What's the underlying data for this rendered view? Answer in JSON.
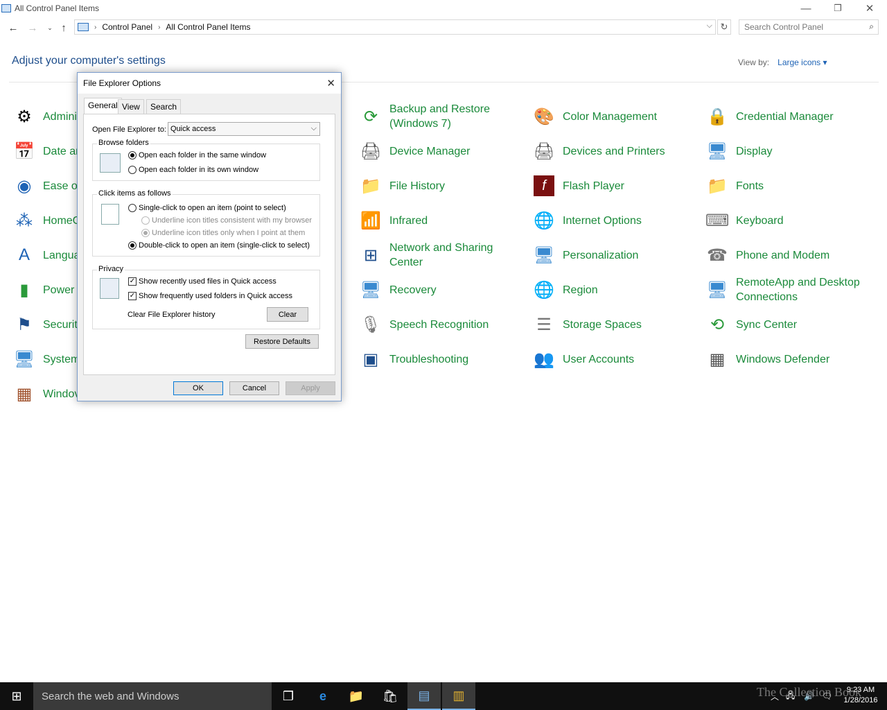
{
  "window": {
    "title": "All Control Panel Items",
    "controls": {
      "minimize": "—",
      "restore": "❐",
      "close": "✕"
    }
  },
  "address": {
    "breadcrumb": [
      "Control Panel",
      "All Control Panel Items"
    ],
    "search_placeholder": "Search Control Panel"
  },
  "header": {
    "title": "Adjust your computer's settings",
    "view_by_label": "View by:",
    "view_by_value": "Large icons"
  },
  "items": [
    {
      "label": "Admini",
      "icon": "admin-tools-icon"
    },
    {
      "label": "Date ar",
      "icon": "datetime-icon"
    },
    {
      "label": "Ease of",
      "icon": "ease-of-access-icon"
    },
    {
      "label": "HomeG",
      "icon": "homegroup-icon"
    },
    {
      "label": "Langua",
      "icon": "language-icon"
    },
    {
      "label": "Power",
      "icon": "power-icon"
    },
    {
      "label": "Securit",
      "icon": "security-flag-icon"
    },
    {
      "label": "System",
      "icon": "system-icon"
    },
    {
      "label": "Windov",
      "icon": "firewall-icon"
    },
    {
      "label": "Backup and Restore (Windows 7)",
      "icon": "backup-icon"
    },
    {
      "label": "Device Manager",
      "icon": "device-manager-icon"
    },
    {
      "label": "File History",
      "icon": "file-history-icon"
    },
    {
      "label": "Infrared",
      "icon": "infrared-icon"
    },
    {
      "label": "Network and Sharing Center",
      "icon": "network-icon"
    },
    {
      "label": "Recovery",
      "icon": "recovery-icon"
    },
    {
      "label": "Speech Recognition",
      "icon": "microphone-icon"
    },
    {
      "label": "Troubleshooting",
      "icon": "troubleshooting-icon"
    },
    {
      "label": "Color Management",
      "icon": "color-management-icon"
    },
    {
      "label": "Devices and Printers",
      "icon": "printer-icon"
    },
    {
      "label": "Flash Player",
      "icon": "flash-icon"
    },
    {
      "label": "Internet Options",
      "icon": "internet-options-icon"
    },
    {
      "label": "Personalization",
      "icon": "personalization-icon"
    },
    {
      "label": "Region",
      "icon": "region-globe-icon"
    },
    {
      "label": "Storage Spaces",
      "icon": "storage-icon"
    },
    {
      "label": "User Accounts",
      "icon": "users-icon"
    },
    {
      "label": "Credential Manager",
      "icon": "credential-icon"
    },
    {
      "label": "Display",
      "icon": "display-icon"
    },
    {
      "label": "Fonts",
      "icon": "fonts-icon"
    },
    {
      "label": "Keyboard",
      "icon": "keyboard-icon"
    },
    {
      "label": "Phone and Modem",
      "icon": "phone-icon"
    },
    {
      "label": "RemoteApp and Desktop Connections",
      "icon": "remoteapp-icon"
    },
    {
      "label": "Sync Center",
      "icon": "sync-icon"
    },
    {
      "label": "Windows Defender",
      "icon": "defender-icon"
    }
  ],
  "dialog": {
    "title": "File Explorer Options",
    "tabs": [
      "General",
      "View",
      "Search"
    ],
    "open_to_label": "Open File Explorer to:",
    "open_to_value": "Quick access",
    "browse_group": "Browse folders",
    "browse_same": "Open each folder in the same window",
    "browse_own": "Open each folder in its own window",
    "click_group": "Click items as follows",
    "single_click": "Single-click to open an item (point to select)",
    "underline_browser": "Underline icon titles consistent with my browser",
    "underline_point": "Underline icon titles only when I point at them",
    "double_click": "Double-click to open an item (single-click to select)",
    "privacy_group": "Privacy",
    "show_recent_files": "Show recently used files in Quick access",
    "show_frequent_folders": "Show frequently used folders in Quick access",
    "clear_history_label": "Clear File Explorer history",
    "clear_button": "Clear",
    "restore_defaults": "Restore Defaults",
    "ok": "OK",
    "cancel": "Cancel",
    "apply": "Apply"
  },
  "taskbar": {
    "search_placeholder": "Search the web and Windows",
    "time": "9:23 AM",
    "date": "1/28/2016"
  },
  "watermark": "The Collection Book"
}
